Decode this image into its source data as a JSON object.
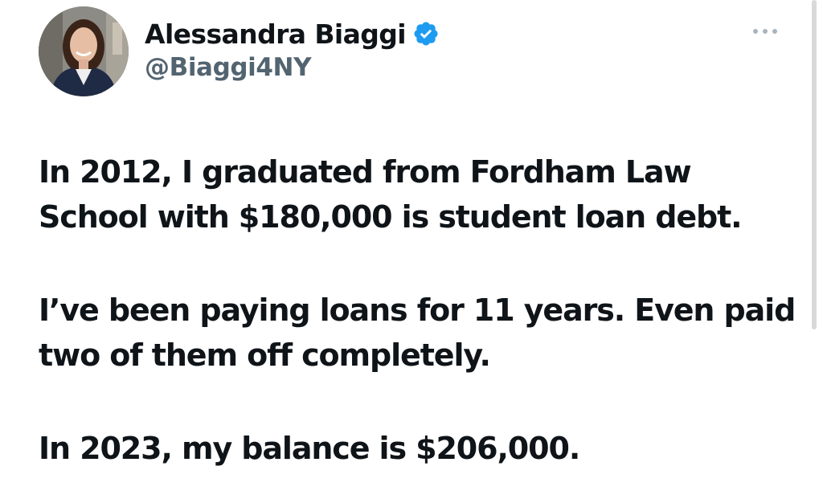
{
  "author": {
    "display_name": "Alessandra Biaggi",
    "handle": "@Biaggi4NY",
    "verified": true,
    "verified_badge_color": "#1d9bf0"
  },
  "tweet": {
    "paragraphs": [
      [
        "In 2012, I graduated from Fordham Law",
        "School with $180,000 is student loan debt."
      ],
      [
        "I’ve been paying loans for 11 years. Even paid",
        "two of them off completely."
      ],
      [
        "In 2023, my balance is $206,000."
      ]
    ]
  },
  "icons": {
    "avatar": "avatar",
    "verified": "verified-badge-icon",
    "more": "more-options-icon"
  },
  "colors": {
    "text": "#0f1419",
    "handle": "#536471",
    "background": "#ffffff"
  }
}
